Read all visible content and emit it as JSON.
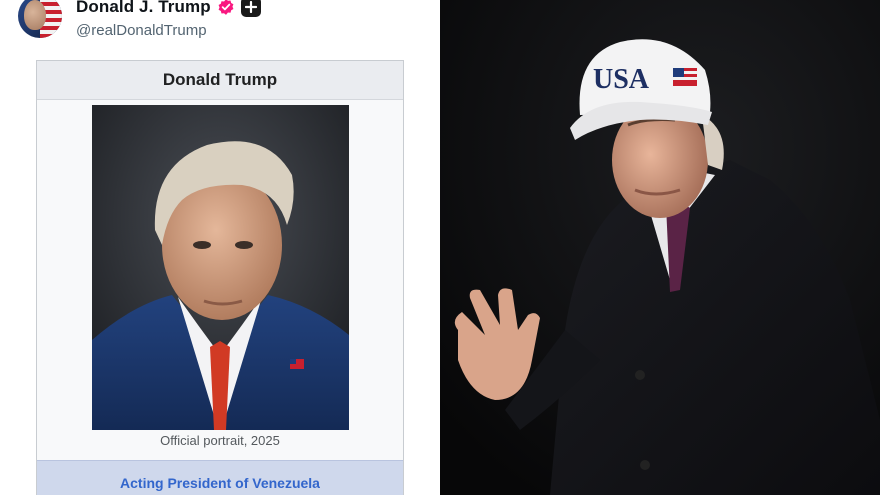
{
  "post": {
    "display_name": "Donald J. Trump",
    "handle": "@realDonaldTrump"
  },
  "infobox": {
    "title": "Donald Trump",
    "caption": "Official portrait, 2025",
    "office": "Acting President of Venezuela"
  },
  "photo": {
    "cap_text": "USA"
  },
  "icons": {
    "verified": "verified-badge-icon",
    "plus": "plus-badge-icon"
  },
  "colors": {
    "verified_badge": "#f91880",
    "link": "#3366cc",
    "office_bar": "#cfd8ec"
  }
}
